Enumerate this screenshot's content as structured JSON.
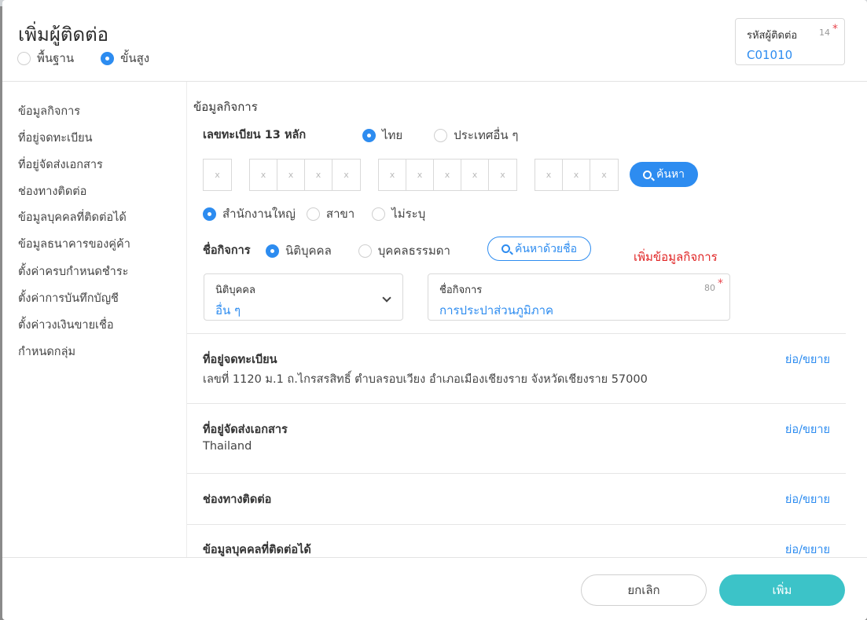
{
  "header": {
    "title": "เพิ่มผู้ติดต่อ",
    "modes": [
      {
        "label": "พื้นฐาน",
        "checked": false
      },
      {
        "label": "ขั้นสูง",
        "checked": true
      }
    ],
    "code": {
      "label": "รหัสผู้ติดต่อ",
      "count": "14",
      "required": "*",
      "value": "C01010"
    }
  },
  "sidebar": {
    "items": [
      {
        "label": "ข้อมูลกิจการ"
      },
      {
        "label": "ที่อยู่จดทะเบียน"
      },
      {
        "label": "ที่อยู่จัดส่งเอกสาร"
      },
      {
        "label": "ช่องทางติดต่อ"
      },
      {
        "label": "ข้อมูลบุคคลที่ติดต่อได้"
      },
      {
        "label": "ข้อมูลธนาคารของคู่ค้า"
      },
      {
        "label": "ตั้งค่าครบกำหนดชำระ"
      },
      {
        "label": "ตั้งค่าการบันทึกบัญชี"
      },
      {
        "label": "ตั้งค่าวงเงินขายเชื่อ"
      },
      {
        "label": "กำหนดกลุ่ม"
      }
    ]
  },
  "business": {
    "section_title": "ข้อมูลกิจการ",
    "tax_id_label": "เลขทะเบียน 13 หลัก",
    "country_options": [
      {
        "label": "ไทย",
        "checked": true
      },
      {
        "label": "ประเทศอื่น ๆ",
        "checked": false
      }
    ],
    "id_placeholder": "x",
    "search_button": "ค้นหา",
    "branch_options": [
      {
        "label": "สำนักงานใหญ่",
        "checked": true
      },
      {
        "label": "สาขา",
        "checked": false
      },
      {
        "label": "ไม่ระบุ",
        "checked": false
      }
    ],
    "name_label": "ชื่อกิจการ",
    "entity_options": [
      {
        "label": "นิติบุคคล",
        "checked": true
      },
      {
        "label": "บุคคลธรรมดา",
        "checked": false
      }
    ],
    "search_by_name_button": "ค้นหาด้วยชื่อ",
    "add_business_link": "เพิ่มข้อมูลกิจการ",
    "entity_type_field": {
      "label": "นิติบุคคล",
      "value": "อื่น ๆ"
    },
    "business_name_field": {
      "label": "ชื่อกิจการ",
      "count": "80",
      "required": "*",
      "value": "การประปาส่วนภูมิภาค"
    }
  },
  "accordions": [
    {
      "title": "ที่อยู่จดทะเบียน",
      "subtitle": "เลขที่ 1120 ม.1 ถ.ไกรสรสิทธิ์ ตำบลรอบเวียง อำเภอเมืองเชียงราย จังหวัดเชียงราย 57000",
      "toggle": "ย่อ/ขยาย"
    },
    {
      "title": "ที่อยู่จัดส่งเอกสาร",
      "subtitle": "Thailand",
      "toggle": "ย่อ/ขยาย"
    },
    {
      "title": "ช่องทางติดต่อ",
      "subtitle": "",
      "toggle": "ย่อ/ขยาย"
    },
    {
      "title": "ข้อมูลบุคคลที่ติดต่อได้",
      "subtitle": "",
      "toggle": "ย่อ/ขยาย"
    }
  ],
  "footer": {
    "cancel_label": "ยกเลิก",
    "add_label": "เพิ่ม"
  },
  "colors": {
    "primary": "#2d8cf0",
    "confirm": "#3cc3c8",
    "required": "#e8464e",
    "add_link": "#e02323"
  }
}
